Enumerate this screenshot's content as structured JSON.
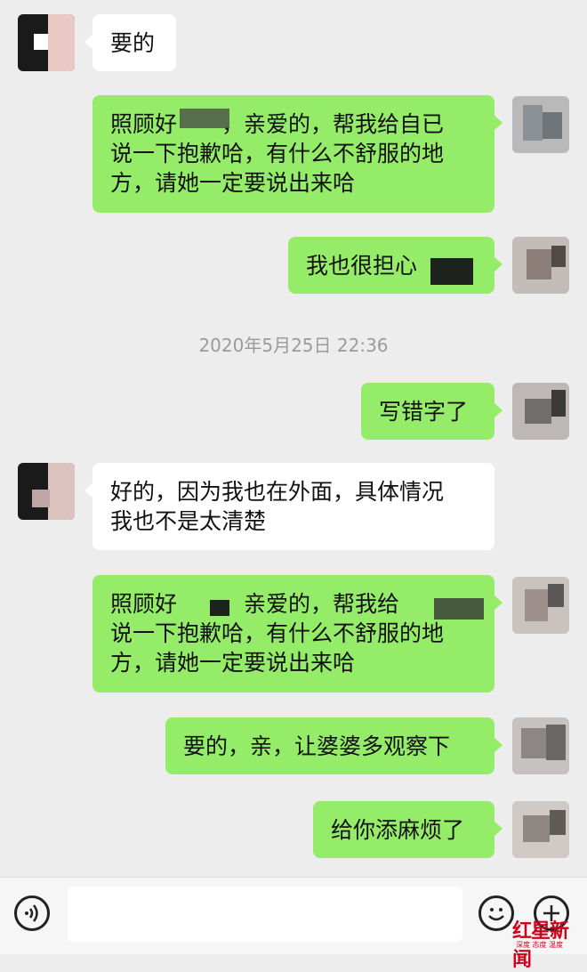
{
  "chat": {
    "timestamp": "2020年5月25日 22:36",
    "messages": [
      {
        "side": "left",
        "text": "要的"
      },
      {
        "side": "right",
        "text": "照顾好　　，亲爱的，帮我给自已\n说一下抱歉哈，有什么不舒服的地\n方，请她一定要说出来哈"
      },
      {
        "side": "right",
        "text": "我也很担心　　"
      },
      {
        "side": "right",
        "text": "写错字了"
      },
      {
        "side": "left",
        "text": "好的，因为我也在外面，具体情况\n我也不是太清楚"
      },
      {
        "side": "right",
        "text": "照顾好　　，亲爱的，帮我给　　\n说一下抱歉哈，有什么不舒服的地\n方，请她一定要说出来哈"
      },
      {
        "side": "right",
        "text": "要的，亲，让婆婆多观察下"
      },
      {
        "side": "right",
        "text": "给你添麻烦了"
      }
    ]
  },
  "input_bar": {
    "voice_icon": "voice-icon",
    "emoji_icon": "emoji-icon",
    "plus_icon": "plus-icon"
  },
  "watermark": {
    "main": "红星新闻",
    "sub": "深度 态度 温度"
  },
  "colors": {
    "background": "#ededed",
    "own_bubble": "#95ec69",
    "other_bubble": "#ffffff"
  }
}
